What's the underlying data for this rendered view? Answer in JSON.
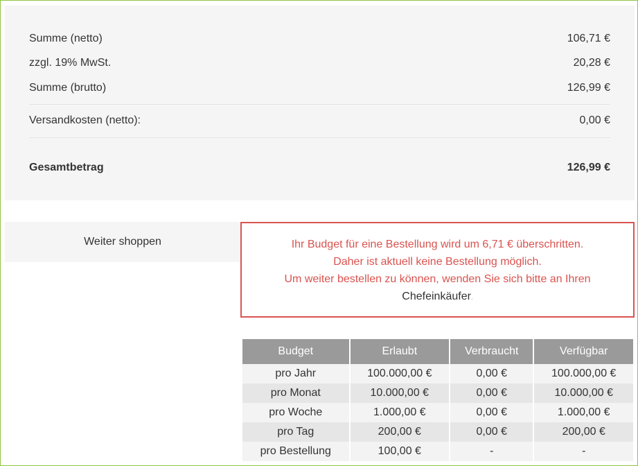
{
  "summary": {
    "net_label": "Summe (netto)",
    "net_value": "106,71 €",
    "vat_label": "zzgl. 19% MwSt.",
    "vat_value": "20,28 €",
    "gross_label": "Summe (brutto)",
    "gross_value": "126,99 €",
    "shipping_label": "Versandkosten (netto):",
    "shipping_value": "0,00 €",
    "total_label": "Gesamtbetrag",
    "total_value": "126,99 €"
  },
  "actions": {
    "continue_shopping": "Weiter shoppen"
  },
  "alert": {
    "line1": "Ihr Budget für eine Bestellung wird um 6,71 € überschritten.",
    "line2": "Daher ist aktuell keine Bestellung möglich.",
    "line3": "Um weiter bestellen zu können, wenden Sie sich bitte an Ihren",
    "line4": "Chefeinkäufer",
    "line4_suffix": "."
  },
  "budget_table": {
    "headers": [
      "Budget",
      "Erlaubt",
      "Verbraucht",
      "Verfügbar"
    ],
    "rows": [
      [
        "pro Jahr",
        "100.000,00 €",
        "0,00 €",
        "100.000,00 €"
      ],
      [
        "pro Monat",
        "10.000,00 €",
        "0,00 €",
        "10.000,00 €"
      ],
      [
        "pro Woche",
        "1.000,00 €",
        "0,00 €",
        "1.000,00 €"
      ],
      [
        "pro Tag",
        "200,00 €",
        "0,00 €",
        "200,00 €"
      ],
      [
        "pro Bestellung",
        "100,00 €",
        "-",
        "-"
      ]
    ]
  },
  "colors": {
    "frame_border": "#8dc63f",
    "alert_red": "#d9534f",
    "table_header": "#9a9a9a"
  }
}
